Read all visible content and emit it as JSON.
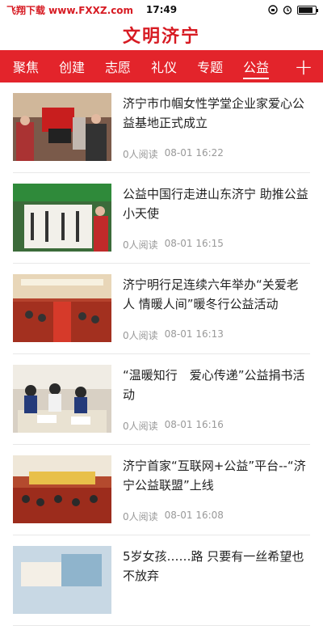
{
  "status_bar": {
    "site": "飞翔下载 www.FXXZ.com",
    "time": "17:49"
  },
  "header": {
    "title": "文明济宁"
  },
  "nav": {
    "tabs": [
      "聚焦",
      "创建",
      "志愿",
      "礼仪",
      "专题",
      "公益"
    ],
    "active_tab": "公益",
    "add_label": "+"
  },
  "feed": [
    {
      "title": "济宁市巾帼女性学堂企业家爱心公益基地正式成立",
      "reads": "0人阅读",
      "time": "08-01 16:22"
    },
    {
      "title": "公益中国行走进山东济宁 助推公益小天使",
      "reads": "0人阅读",
      "time": "08-01 16:15"
    },
    {
      "title": "济宁明行足连续六年举办“关爱老人 情暖人间”暖冬行公益活动",
      "reads": "0人阅读",
      "time": "08-01 16:13"
    },
    {
      "title": "“温暖知行　爱心传递”公益捐书活动",
      "reads": "0人阅读",
      "time": "08-01 16:16"
    },
    {
      "title": "济宁首家“互联网+公益”平台--“济宁公益联盟”上线",
      "reads": "0人阅读",
      "time": "08-01 16:08"
    },
    {
      "title": "5岁女孩……路 只要有一丝希望也不放弃",
      "reads": "",
      "time": ""
    }
  ],
  "colors": {
    "brand_red": "#e3242b",
    "title_red": "#d71b23"
  }
}
